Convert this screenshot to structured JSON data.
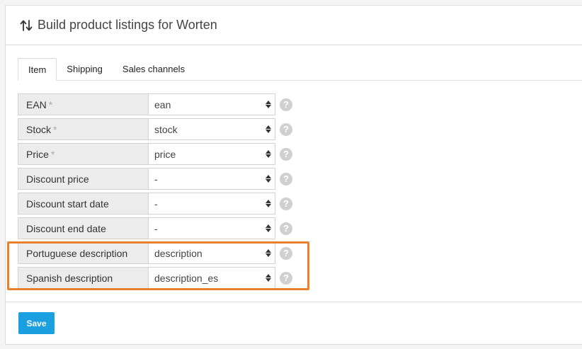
{
  "header": {
    "title": "Build product listings for Worten",
    "icon": "sort-arrows-icon"
  },
  "tabs": [
    {
      "label": "Item",
      "active": true
    },
    {
      "label": "Shipping",
      "active": false
    },
    {
      "label": "Sales channels",
      "active": false
    }
  ],
  "fields": [
    {
      "label": "EAN",
      "required": "*",
      "value": "ean"
    },
    {
      "label": "Stock",
      "required": "*",
      "value": "stock"
    },
    {
      "label": "Price",
      "required": "*",
      "value": "price"
    },
    {
      "label": "Discount price",
      "required": "",
      "value": "-"
    },
    {
      "label": "Discount start date",
      "required": "",
      "value": "-"
    },
    {
      "label": "Discount end date",
      "required": "",
      "value": "-"
    },
    {
      "label": "Portuguese description",
      "required": "",
      "value": "description"
    },
    {
      "label": "Spanish description",
      "required": "",
      "value": "description_es"
    }
  ],
  "help_glyph": "?",
  "footer": {
    "save_label": "Save"
  },
  "colors": {
    "accent": "#1a9fe0",
    "highlight": "#e8812f",
    "label_bg": "#ececec"
  }
}
